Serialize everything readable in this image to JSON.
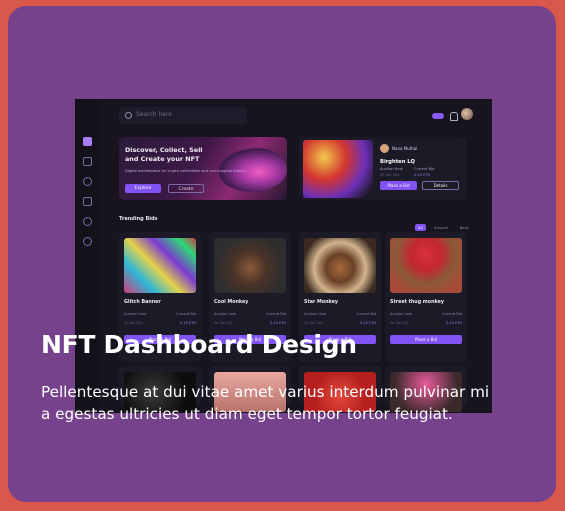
{
  "colors": {
    "page_bg": "#d9584b",
    "card_bg": "#76428c",
    "app_bg": "#17141f",
    "accent": "#8153f2"
  },
  "card": {
    "title": "NFT Dashboard Design",
    "description": "Pellentesque at dui vitae amet varius interdum pulvinar mi a egestas ultricies ut diam eget tempor tortor feugiat."
  },
  "app": {
    "search_placeholder": "Search here",
    "hero": {
      "title_line1": "Discover, Collect, Sell",
      "title_line2": "and Create your NFT",
      "subtitle": "Digital marketplace for crypto collectibles and non-fungible tokens",
      "explore_label": "Explore",
      "create_label": "Create"
    },
    "featured": {
      "owner": "Nana Muthai",
      "name": "Birghten LQ",
      "auction_label": "Auction time",
      "bid_label": "Current Bid",
      "auction_value": "2h 3m 32s",
      "bid_value": "0.45 ETH",
      "place_bid_label": "Place a Bid",
      "details_label": "Details"
    },
    "trending": {
      "title": "Trending Bids",
      "filters": [
        "All",
        "Artwork",
        "Book"
      ],
      "items": [
        {
          "name": "Glitch Banner",
          "auction_label": "Auction time",
          "bid_label": "Current Bid",
          "auction_value": "2h 3m 32s",
          "bid_value": "0.15 ETH",
          "button": "Place a Bid"
        },
        {
          "name": "Cool Monkey",
          "auction_label": "Auction time",
          "bid_label": "Current Bid",
          "auction_value": "2h 3m 32s",
          "bid_value": "0.15 ETH",
          "button": "Place a Bid"
        },
        {
          "name": "Star Monkey",
          "auction_label": "Auction time",
          "bid_label": "Current Bid",
          "auction_value": "2h 3m 32s",
          "bid_value": "0.15 ETH",
          "button": "Place a Bid"
        },
        {
          "name": "Street thug monkey",
          "auction_label": "Auction time",
          "bid_label": "Current Bid",
          "auction_value": "2h 3m 32s",
          "bid_value": "0.15 ETH",
          "button": "Place a Bid"
        }
      ]
    }
  }
}
